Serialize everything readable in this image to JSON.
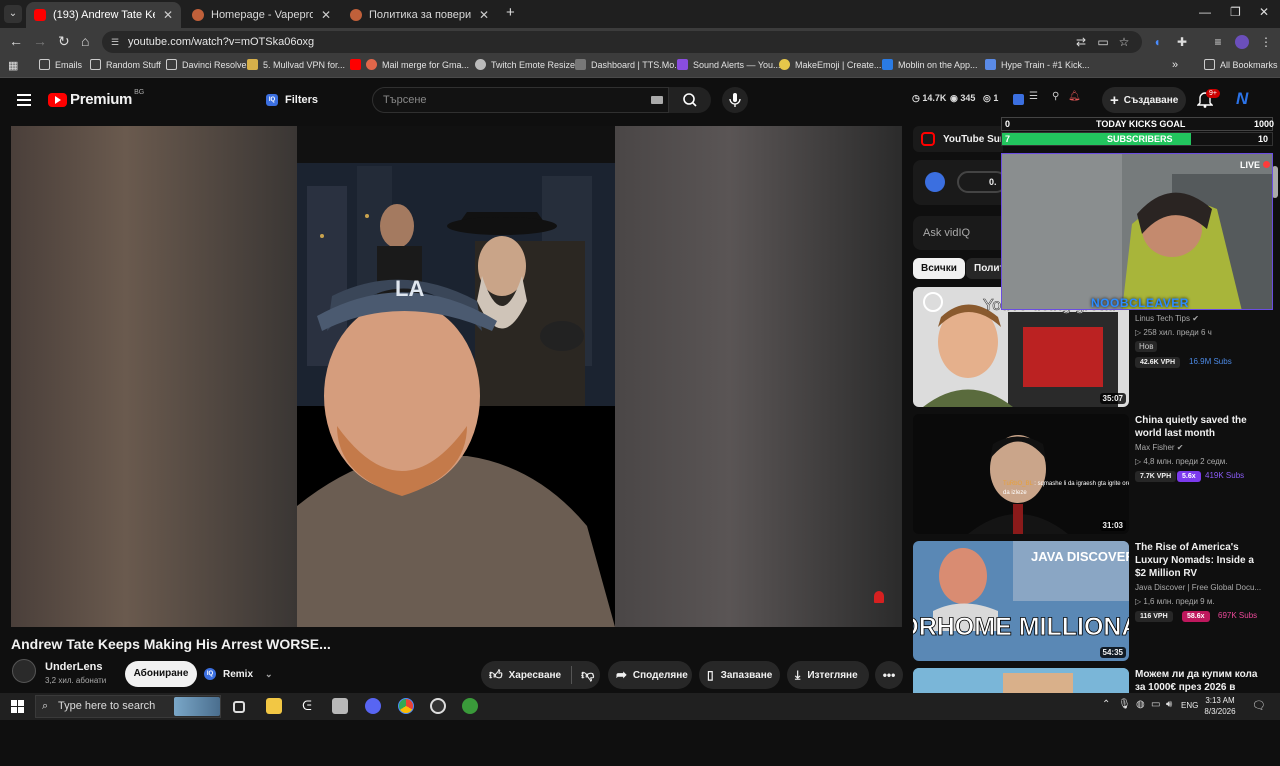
{
  "tabs": [
    {
      "title": "(193) Andrew Tate Keeps Making",
      "active": true
    },
    {
      "title": "Homepage - Vapepro",
      "active": false
    },
    {
      "title": "Политика за поверителност и",
      "active": false
    }
  ],
  "address_bar": {
    "url": "youtube.com/watch?v=mOTSka06oxg"
  },
  "bookmarks": [
    "Emails",
    "Random Stuff",
    "Davinci Resolve",
    "5. Mullvad VPN for...",
    "Mail merge for Gma...",
    "Twitch Emote Resizer",
    "Dashboard | TTS.Mo...",
    "Sound Alerts — You...",
    "MakeEmoji | Create...",
    "Moblin on the App...",
    "Hype Train - #1 Kick..."
  ],
  "all_bookmarks": "All Bookmarks",
  "youtube": {
    "logo_word": "Premium",
    "logo_region": "BG",
    "filters_label": "Filters",
    "search_placeholder": "Търсене",
    "stats": {
      "views": "14.7K",
      "watching": "345",
      "other": "1"
    },
    "create_label": "Създаване",
    "notifications_badge": "9+",
    "avatar_letter": "N"
  },
  "video": {
    "title": "Andrew Tate Keeps Making His Arrest WORSE...",
    "channel": "UnderLens",
    "subscribers": "3,2 хил. абонати",
    "subscribe_label": "Абониране",
    "remix_label": "Remix",
    "like_label": "Харесване",
    "share_label": "Споделяне",
    "save_label": "Запазване",
    "download_label": "Изтегляне"
  },
  "sidebar": {
    "summit_label": "YouTube Summit",
    "vidiq_value": "0.",
    "ask_placeholder": "Ask vidIQ",
    "chips": [
      "Всички",
      "Политика"
    ],
    "recommendations": [
      {
        "title": "You're doing great!",
        "channel": "Linus Tech Tips",
        "meta": "▷ 258 хил.  преди 6 ч",
        "badge": "Нов",
        "vph": "42.6K VPH",
        "multiplier": "",
        "subs": "16.9M Subs",
        "duration": "35:07"
      },
      {
        "title": "China quietly saved the world last month",
        "channel": "Max Fisher",
        "meta": "▷ 4,8 млн.  преди 2 седм.",
        "vph": "7.7K VPH",
        "multiplier": "5.6x",
        "subs": "419K Subs",
        "duration": "31:03"
      },
      {
        "title": "The Rise of America's Luxury Nomads: Inside a $2 Million RV",
        "channel": "Java Discover | Free Global Docu...",
        "meta": "▷ 1,6 млн.  преди 9 м.",
        "vph": "116 VPH",
        "multiplier": "58.6x",
        "subs": "697K Subs",
        "duration": "54:35",
        "thumb_text_1": "JAVA DISCOVER",
        "thumb_text_2": "MOTORHOME MILLIONAIRES"
      },
      {
        "title": "Можем ли да купим кола за 1000€ през 2026 в",
        "channel": "",
        "meta": "",
        "vph": "",
        "multiplier": "",
        "subs": "",
        "duration": ""
      }
    ]
  },
  "overlay": {
    "goal_label": "TODAY KICKS GOAL",
    "goal_min": "0",
    "goal_max": "1000",
    "goal_progress": 0.0,
    "subs_label": "SUBSCRIBERS",
    "subs_min": "7",
    "subs_max": "10",
    "subs_progress": 0.7,
    "live_label": "LIVE",
    "streamer_name": "NOOBCLEAVER",
    "chat_user": "TuRbO_BL",
    "chat_message": "sqmashe li da igraesh gta igrite oredi gta 6 da izleze"
  },
  "taskbar": {
    "search_placeholder": "Type here to search",
    "language": "ENG",
    "time": "3:13 AM",
    "date": "8/3/2026"
  },
  "colors": {
    "youtube_red": "#ff0000",
    "vidiq_blue": "#3b6fe0",
    "subs_green": "#22c55e",
    "background": "#0f0f0f"
  }
}
